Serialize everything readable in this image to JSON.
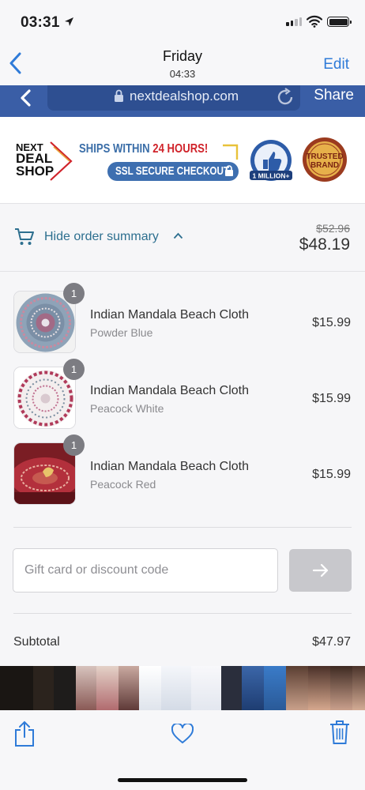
{
  "status_bar": {
    "time": "03:31"
  },
  "nav": {
    "title": "Friday",
    "subtitle": "04:33",
    "edit_label": "Edit"
  },
  "browser": {
    "url": "nextdealshop.com",
    "share_label": "Share"
  },
  "shop_header": {
    "logo_lines": [
      "NEXT",
      "DEAL",
      "SHOP"
    ],
    "ships_prefix": "SHIPS WITHIN ",
    "ships_highlight": "24 HOURS!",
    "ssl_label": "SSL SECURE CHECKOUT",
    "badge_million": "1 MILLION+",
    "badge_trusted_line1": "TRUSTED",
    "badge_trusted_line2": "BRAND"
  },
  "summary": {
    "toggle_label": "Hide order summary",
    "original_total": "$52.96",
    "total": "$48.19"
  },
  "items": [
    {
      "name": "Indian Mandala Beach Cloth",
      "variant": "Powder Blue",
      "price": "$15.99",
      "qty": "1"
    },
    {
      "name": "Indian Mandala Beach Cloth",
      "variant": "Peacock White",
      "price": "$15.99",
      "qty": "1"
    },
    {
      "name": "Indian Mandala Beach Cloth",
      "variant": "Peacock Red",
      "price": "$15.99",
      "qty": "1"
    }
  ],
  "discount": {
    "placeholder": "Gift card or discount code"
  },
  "subtotal": {
    "label": "Subtotal",
    "value": "$47.97"
  },
  "colors": {
    "accent_blue": "#2f7bd8",
    "browser_bar": "#3a5ea6",
    "link_teal": "#2d6f8f",
    "badge_gray": "#7c7c82"
  },
  "icons": {
    "nav_back": "chevron-left-icon",
    "location": "location-arrow-icon",
    "wifi": "wifi-icon",
    "battery": "battery-icon",
    "lock": "lock-icon",
    "reload": "reload-icon",
    "cart": "cart-icon",
    "apply": "arrow-right-icon",
    "share": "share-icon",
    "favorite": "heart-icon",
    "delete": "trash-icon"
  }
}
